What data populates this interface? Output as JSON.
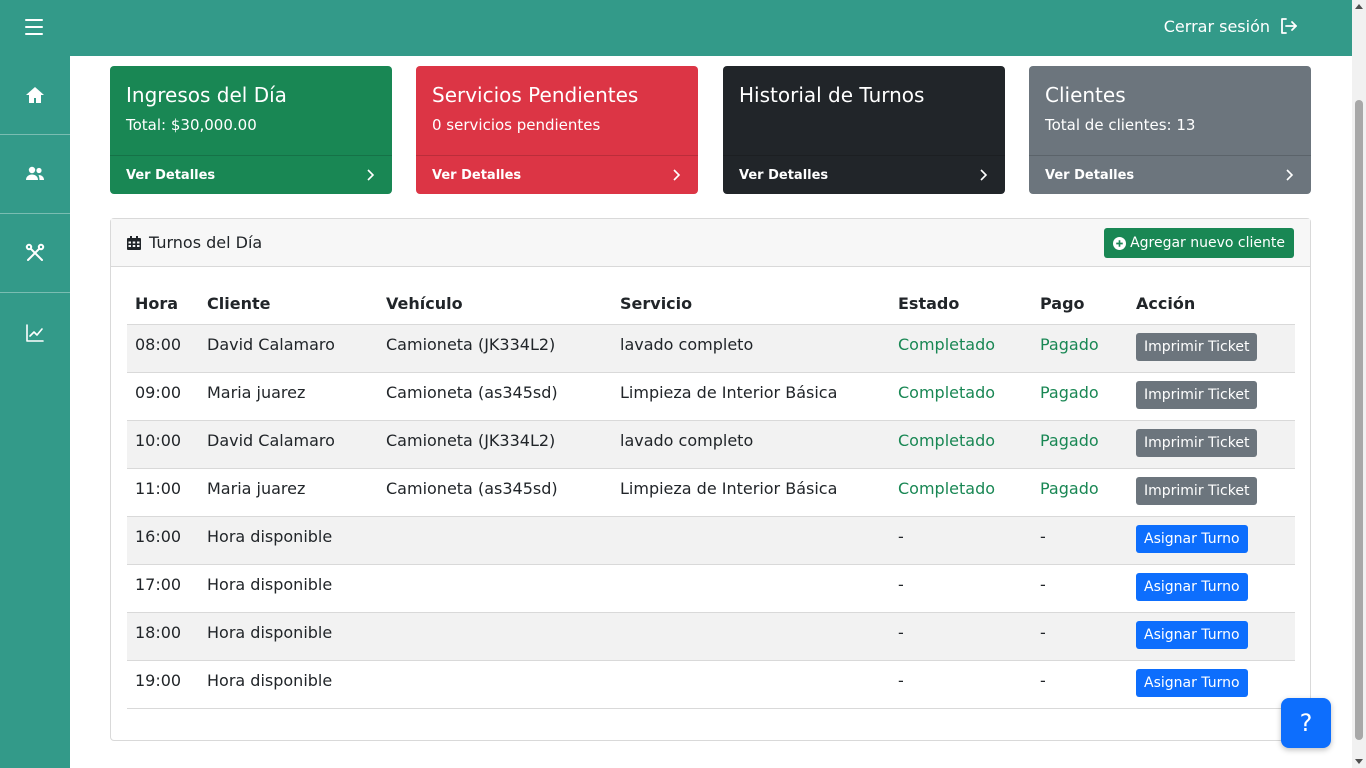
{
  "header": {
    "logout_label": "Cerrar sesión"
  },
  "sidebar": {
    "items": [
      {
        "icon": "home-icon"
      },
      {
        "icon": "users-icon"
      },
      {
        "icon": "tools-icon"
      },
      {
        "icon": "chart-line-icon"
      }
    ]
  },
  "cards": [
    {
      "title": "Ingresos del Día",
      "text": "Total: $30,000.00",
      "footer": "Ver Detalles",
      "color": "#198754"
    },
    {
      "title": "Servicios Pendientes",
      "text": "0 servicios pendientes",
      "footer": "Ver Detalles",
      "color": "#dc3545"
    },
    {
      "title": "Historial de Turnos",
      "text": "",
      "footer": "Ver Detalles",
      "color": "#212529"
    },
    {
      "title": "Clientes",
      "text": "Total de clientes: 13",
      "footer": "Ver Detalles",
      "color": "#6c757d"
    }
  ],
  "turnos": {
    "title": "Turnos del Día",
    "add_button": "Agregar nuevo cliente",
    "columns": [
      "Hora",
      "Cliente",
      "Vehículo",
      "Servicio",
      "Estado",
      "Pago",
      "Acción"
    ],
    "rows": [
      {
        "hora": "08:00",
        "cliente": "David Calamaro",
        "vehiculo": "Camioneta (JK334L2)",
        "servicio": "lavado completo",
        "estado": "Completado",
        "pago": "Pagado",
        "accion": "Imprimir Ticket"
      },
      {
        "hora": "09:00",
        "cliente": "Maria juarez",
        "vehiculo": "Camioneta (as345sd)",
        "servicio": "Limpieza de Interior Básica",
        "estado": "Completado",
        "pago": "Pagado",
        "accion": "Imprimir Ticket"
      },
      {
        "hora": "10:00",
        "cliente": "David Calamaro",
        "vehiculo": "Camioneta (JK334L2)",
        "servicio": "lavado completo",
        "estado": "Completado",
        "pago": "Pagado",
        "accion": "Imprimir Ticket"
      },
      {
        "hora": "11:00",
        "cliente": "Maria juarez",
        "vehiculo": "Camioneta (as345sd)",
        "servicio": "Limpieza de Interior Básica",
        "estado": "Completado",
        "pago": "Pagado",
        "accion": "Imprimir Ticket"
      },
      {
        "hora": "16:00",
        "cliente": "Hora disponible",
        "vehiculo": "",
        "servicio": "",
        "estado": "-",
        "pago": "-",
        "accion": "Asignar Turno"
      },
      {
        "hora": "17:00",
        "cliente": "Hora disponible",
        "vehiculo": "",
        "servicio": "",
        "estado": "-",
        "pago": "-",
        "accion": "Asignar Turno"
      },
      {
        "hora": "18:00",
        "cliente": "Hora disponible",
        "vehiculo": "",
        "servicio": "",
        "estado": "-",
        "pago": "-",
        "accion": "Asignar Turno"
      },
      {
        "hora": "19:00",
        "cliente": "Hora disponible",
        "vehiculo": "",
        "servicio": "",
        "estado": "-",
        "pago": "-",
        "accion": "Asignar Turno"
      }
    ]
  },
  "help_button": "?"
}
